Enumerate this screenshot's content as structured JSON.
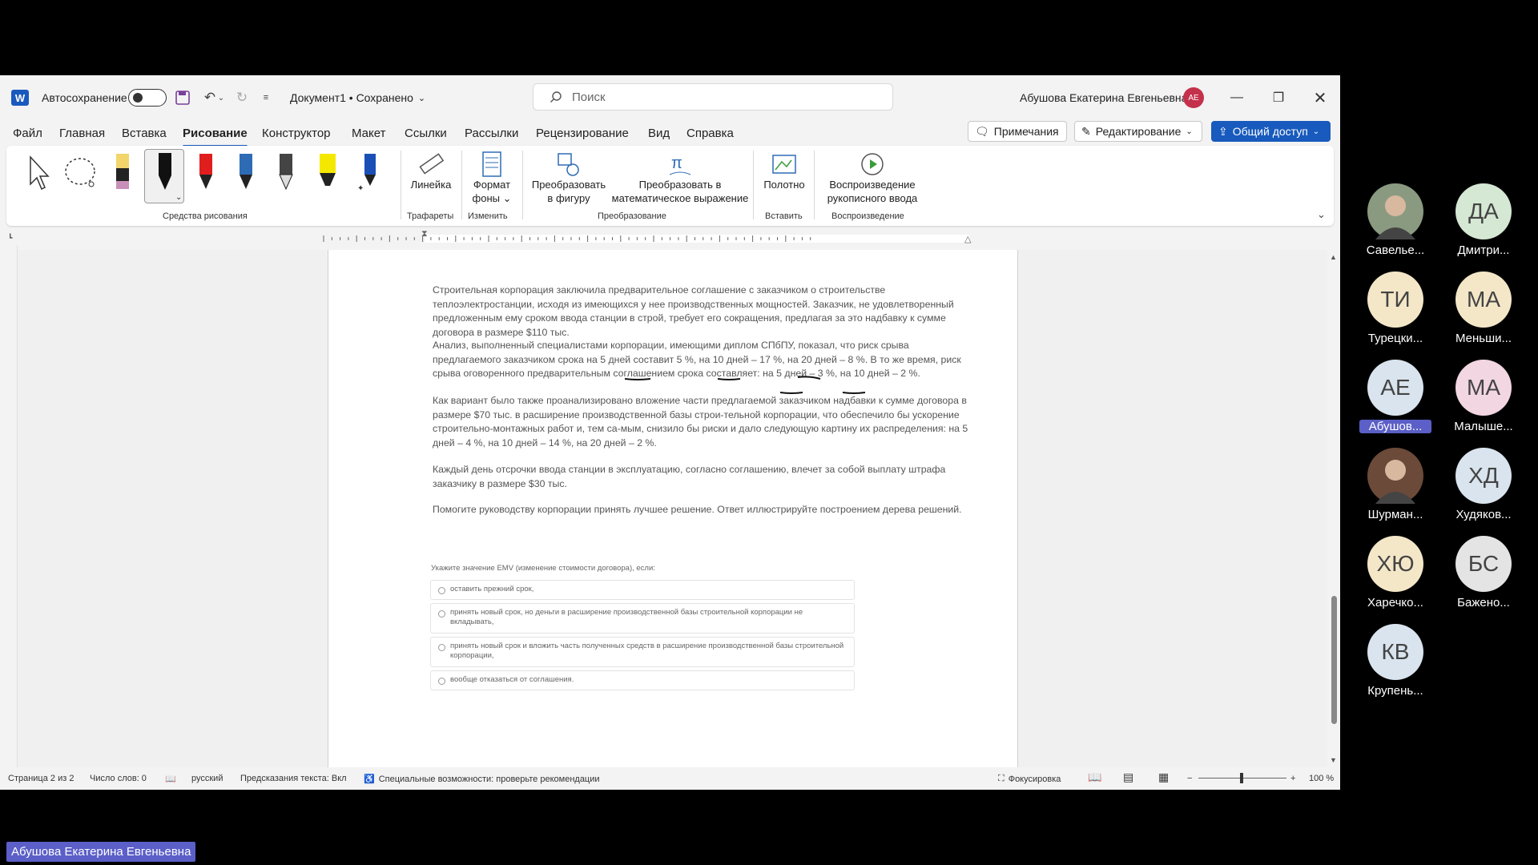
{
  "titlebar": {
    "autosave_label": "Автосохранение",
    "doc_title": "Документ1 • Сохранено",
    "search_placeholder": "Поиск",
    "user_name": "Абушова Екатерина Евгеньевна",
    "user_initials": "АЕ"
  },
  "menu": {
    "tabs": [
      "Файл",
      "Главная",
      "Вставка",
      "Рисование",
      "Конструктор",
      "Макет",
      "Ссылки",
      "Рассылки",
      "Рецензирование",
      "Вид",
      "Справка"
    ],
    "active_tab": "Рисование",
    "comments_label": "Примечания",
    "editing_label": "Редактирование",
    "share_label": "Общий доступ"
  },
  "ribbon": {
    "groups": {
      "drawing_tools": "Средства рисования",
      "stencils": "Трафареты",
      "edit": "Изменить",
      "convert": "Преобразование",
      "insert": "Вставить",
      "replay": "Воспроизведение"
    },
    "ruler_label": "Линейка",
    "bg_format_label_1": "Формат",
    "bg_format_label_2": "фоны",
    "to_shape_1": "Преобразовать",
    "to_shape_2": "в фигуру",
    "to_math_1": "Преобразовать в",
    "to_math_2": "математическое выражение",
    "canvas_label": "Полотно",
    "replay_1": "Воспроизведение",
    "replay_2": "рукописного ввода",
    "pen_colors": [
      "#f2d56b",
      "#111111",
      "#e01e1e",
      "#2e6bb5",
      "#222222",
      "#f5e800",
      "#1b4fb8"
    ]
  },
  "document": {
    "paragraphs": [
      "Строительная корпорация заключила предварительное соглашение с заказчиком о строительстве теплоэлектростанции, исходя из имеющихся у нее производственных мощностей. Заказчик, не удовлетворенный предложенным ему сроком ввода станции в строй, требует его сокращения, предлагая за это надбавку к сумме договора в размере $110 тыс.",
      "Анализ, выполненный специалистами корпорации, имеющими диплом СПбПУ, показал, что риск срыва предлагаемого заказчиком срока на 5 дней составит 5 %, на 10 дней – 17 %, на 20 дней – 8 %. В то же время, риск срыва оговоренного предварительным соглашением срока составляет: на 5 дней – 3 %, на 10 дней – 2 %.",
      "Как вариант было также проанализировано вложение части предлагаемой заказчиком надбавки к сумме договора в размере $70 тыс. в расширение производственной базы строи-тельной корпорации, что обеспечило бы ускорение строительно-монтажных работ и, тем са-мым, снизило бы риски и дало следующую картину их распределения: на 5 дней – 4 %, на 10 дней – 14 %, на 20 дней – 2 %.",
      "Каждый день отсрочки ввода станции в эксплуатацию, согласно соглашению, влечет за собой выплату штрафа заказчику в размере $30 тыс.",
      "Помогите руководству корпорации принять лучшее решение. Ответ иллюстрируйте построением дерева решений."
    ],
    "question_label": "Укажите значение EMV (изменение стоимости договора), если:",
    "options": [
      "оставить прежний срок,",
      "принять новый срок, но деньги в расширение производственной базы строительной корпорации не вкладывать,",
      "принять новый срок и вложить часть полученных средств в расширение производственной базы строительной корпорации,",
      "вообще отказаться от соглашения."
    ]
  },
  "statusbar": {
    "page": "Страница 2 из 2",
    "words": "Число слов: 0",
    "language": "русский",
    "predictions": "Предсказания текста: Вкл",
    "accessibility": "Специальные возможности: проверьте рекомендации",
    "focus": "Фокусировка",
    "zoom": "100 %"
  },
  "participants": [
    {
      "initials": "",
      "name": "Савелье...",
      "bg": "#8a9a80",
      "photo": true
    },
    {
      "initials": "ДА",
      "name": "Дмитри...",
      "bg": "#d4e8d4"
    },
    {
      "initials": "ТИ",
      "name": "Турецки...",
      "bg": "#f4e7c8"
    },
    {
      "initials": "МА",
      "name": "Меньши...",
      "bg": "#f4e7c8"
    },
    {
      "initials": "АЕ",
      "name": "Абушов...",
      "bg": "#d9e4ee",
      "highlight": true
    },
    {
      "initials": "МА",
      "name": "Малыше...",
      "bg": "#f2d6e2"
    },
    {
      "initials": "",
      "name": "Шурман...",
      "bg": "#6b4a3a",
      "photo": true
    },
    {
      "initials": "ХД",
      "name": "Худяков...",
      "bg": "#d9e4ee"
    },
    {
      "initials": "ХЮ",
      "name": "Харечко...",
      "bg": "#f4e7c8"
    },
    {
      "initials": "БС",
      "name": "Бажено...",
      "bg": "#e4e4e4"
    },
    {
      "initials": "КВ",
      "name": "Крупень...",
      "bg": "#d9e4ee"
    }
  ],
  "presenter_label": "Абушова Екатерина Евгеньевна"
}
